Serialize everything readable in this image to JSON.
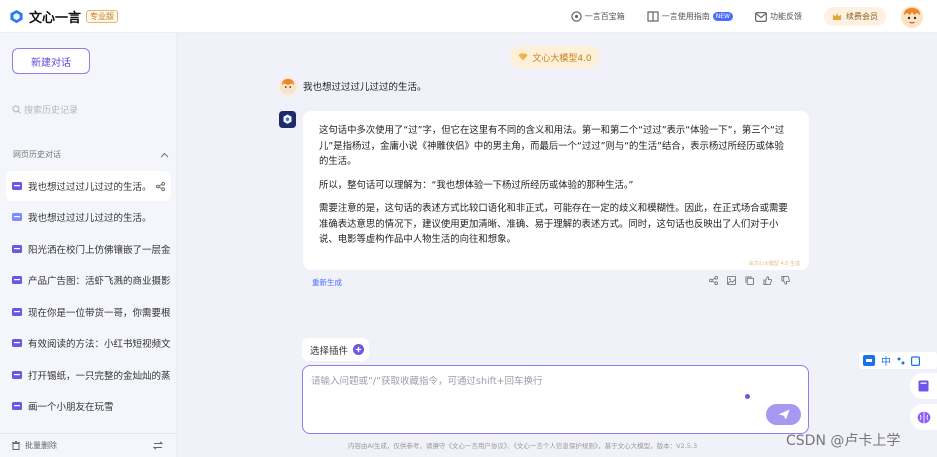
{
  "header": {
    "brand": "文心一言",
    "brand_tag": "专业版",
    "nav": [
      {
        "label": "一言百宝箱",
        "icon": "compass-icon"
      },
      {
        "label": "一言使用指南",
        "icon": "book-icon",
        "badge": "NEW"
      },
      {
        "label": "功能反馈",
        "icon": "mail-icon"
      }
    ],
    "vip_label": "续费会员"
  },
  "sidebar": {
    "new_chat_label": "新建对话",
    "search_placeholder": "搜索历史记录",
    "section_title": "网页历史对话",
    "history": [
      "我也想过过过儿过过的生活。",
      "我也想过过过儿过过的生活。",
      "阳光洒在校门上仿佛镶嵌了一层金",
      "产品广告图：活虾飞溅的商业摄影",
      "现在你是一位带货一哥，你需要根",
      "有效阅读的方法：小红书短视频文",
      "打开锡纸，一只完整的金灿灿的蒸",
      "画一个小朋友在玩雪"
    ],
    "batch_delete_label": "批量删除"
  },
  "chat": {
    "model_tag": "文心大模型4.0",
    "user_message": "我也想过过过儿过过的生活。",
    "answer_paragraphs": [
      "这句话中多次使用了“过”字，但它在这里有不同的含义和用法。第一和第二个“过过”表示“体验一下”，第三个“过儿”是指杨过，金庸小说《神雕侠侣》中的男主角，而最后一个“过过”则与“的生活”结合，表示杨过所经历或体验的生活。",
      "所以，整句话可以理解为：“我也想体验一下杨过所经历或体验的那种生活。”",
      "需要注意的是，这句话的表述方式比较口语化和非正式，可能存在一定的歧义和模糊性。因此，在正式场合或需要准确表达意思的情况下，建议使用更加清晰、准确、易于理解的表述方式。同时，这句话也反映出了人们对于小说、电影等虚构作品中人物生活的向往和想象。"
    ],
    "watermark": "由文心大模型 4.0 生成",
    "regenerate_label": "重新生成"
  },
  "composer": {
    "plugin_label": "选择插件",
    "placeholder": "请输入问题或“/”获取收藏指令，可通过shift+回车换行"
  },
  "footer_text": "内容由AI生成，仅供参考，请遵守《文心一言用户协议》、《文心一言个人信息保护规则》，基于文心大模型，版本：V2.5.3",
  "overlay": {
    "watermark": "CSDN @卢卡上学",
    "tool_char": "中"
  },
  "colors": {
    "accent": "#5b49d9",
    "border": "#8f7df0",
    "send": "#a998f2",
    "link": "#4a6cff"
  }
}
